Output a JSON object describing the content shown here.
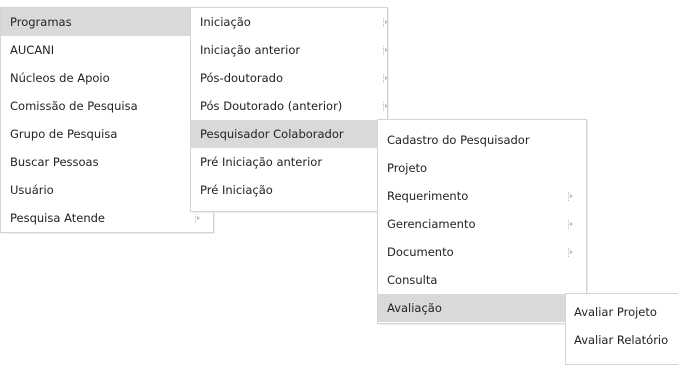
{
  "menus": {
    "main": {
      "items": [
        {
          "label": "Programas"
        },
        {
          "label": "AUCANI"
        },
        {
          "label": "Núcleos de Apoio"
        },
        {
          "label": "Comissão de Pesquisa"
        },
        {
          "label": "Grupo de Pesquisa"
        },
        {
          "label": "Buscar Pessoas"
        },
        {
          "label": "Usuário"
        },
        {
          "label": "Pesquisa Atende"
        }
      ]
    },
    "programas": {
      "items": [
        {
          "label": "Iniciação"
        },
        {
          "label": "Iniciação anterior"
        },
        {
          "label": "Pós-doutorado"
        },
        {
          "label": "Pós Doutorado (anterior)"
        },
        {
          "label": "Pesquisador Colaborador"
        },
        {
          "label": "Pré Iniciação anterior"
        },
        {
          "label": "Pré Iniciação"
        }
      ]
    },
    "pesquisador_colaborador": {
      "items": [
        {
          "label": "Cadastro do Pesquisador"
        },
        {
          "label": "Projeto"
        },
        {
          "label": "Requerimento"
        },
        {
          "label": "Gerenciamento"
        },
        {
          "label": "Documento"
        },
        {
          "label": "Consulta"
        },
        {
          "label": "Avaliação"
        }
      ]
    },
    "avaliacao": {
      "items": [
        {
          "label": "Avaliar Projeto"
        },
        {
          "label": "Avaliar Relatório"
        }
      ]
    }
  },
  "colors": {
    "highlight": "#d9d9d9",
    "border": "#d4d4d4",
    "text": "#222222"
  },
  "icons": {
    "submenu": "dotted-right-arrow-icon"
  }
}
